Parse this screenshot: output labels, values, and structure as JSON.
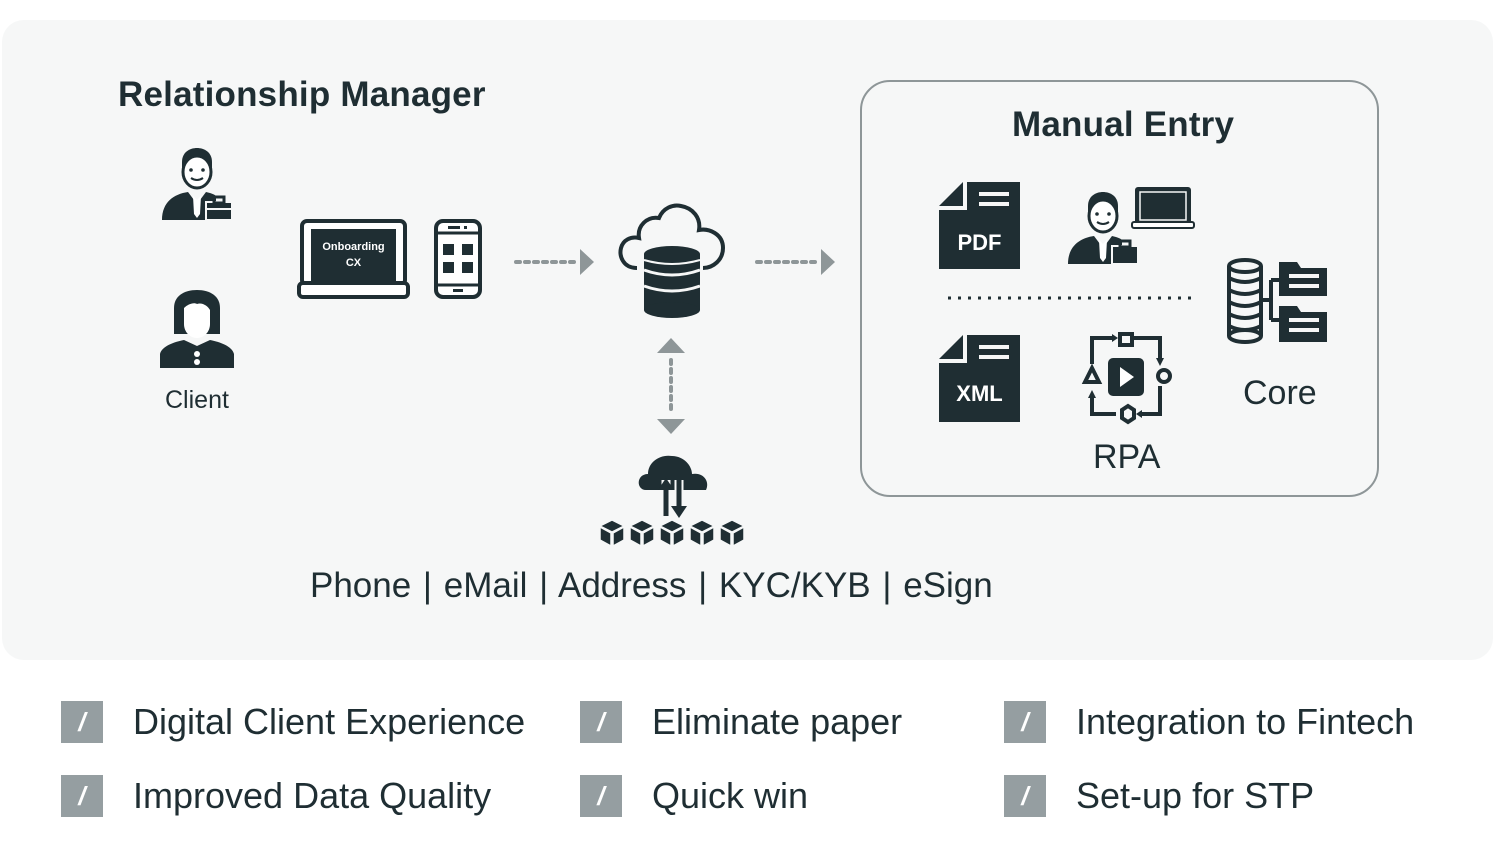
{
  "colors": {
    "panel_bg": "#f6f7f7",
    "icon_dark": "#1f2e33",
    "arrow_gray": "#8e9698",
    "badge_gray": "#959ea1"
  },
  "left": {
    "title": "Relationship Manager",
    "rm_icon": "relationship-manager-icon",
    "client_icon": "client-icon",
    "client_label": "Client"
  },
  "devices": {
    "laptop_screen_line1": "Onboarding",
    "laptop_screen_line2": "CX",
    "phone_icon": "smartphone-app-icon"
  },
  "center": {
    "cloud_db_icon": "cloud-database-icon",
    "integration_icon": "cloud-sync-blocks-icon",
    "sources_text": "Phone | eMail | Address | KYC/KYB | eSign"
  },
  "manual_entry": {
    "title": "Manual Entry",
    "pdf_label": "PDF",
    "xml_label": "XML",
    "rpa_label": "RPA",
    "core_label": "Core"
  },
  "benefits": {
    "badge_glyph": "/",
    "items": [
      "Digital Client Experience",
      "Eliminate paper",
      "Integration to Fintech",
      "Improved Data Quality",
      "Quick win",
      "Set-up for STP"
    ]
  }
}
